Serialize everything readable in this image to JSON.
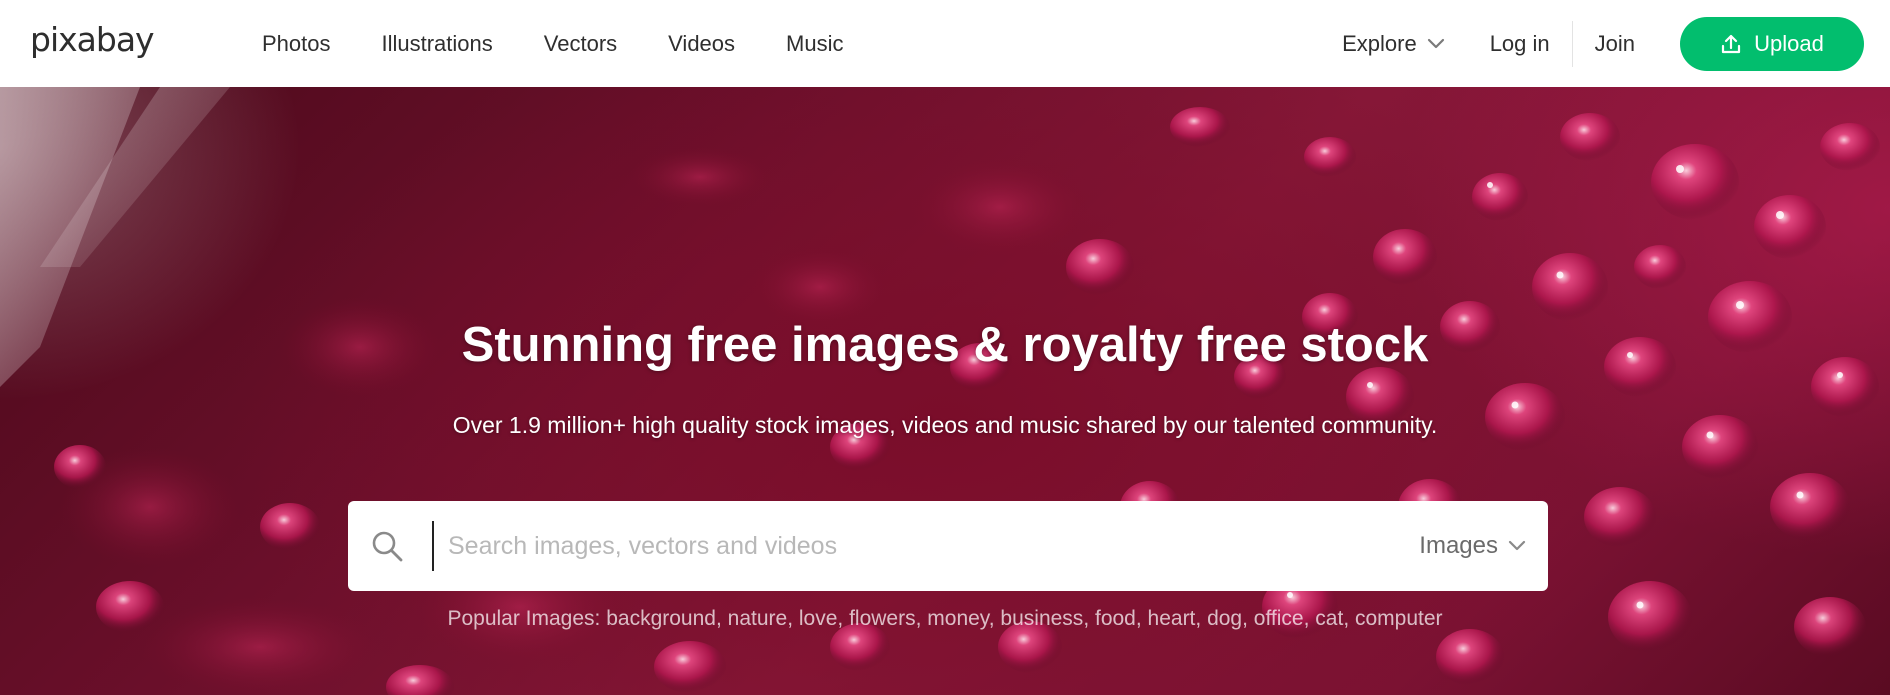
{
  "header": {
    "logo_text": "pixabay",
    "nav": [
      {
        "label": "Photos"
      },
      {
        "label": "Illustrations"
      },
      {
        "label": "Vectors"
      },
      {
        "label": "Videos"
      },
      {
        "label": "Music"
      }
    ],
    "explore_label": "Explore",
    "login_label": "Log in",
    "join_label": "Join",
    "upload_label": "Upload",
    "upload_icon": "upload-icon",
    "accent_color": "#02be6e"
  },
  "hero": {
    "title": "Stunning free images & royalty free stock",
    "subtitle": "Over 1.9 million+ high quality stock images, videos and music shared by our talented community.",
    "search": {
      "placeholder": "Search images, vectors and videos",
      "value": "",
      "icon": "search-icon",
      "media_type": "Images"
    },
    "popular_label": "Popular Images:",
    "popular_tags": [
      "background",
      "nature",
      "love",
      "flowers",
      "money",
      "business",
      "food",
      "heart",
      "dog",
      "office",
      "cat",
      "computer"
    ]
  }
}
